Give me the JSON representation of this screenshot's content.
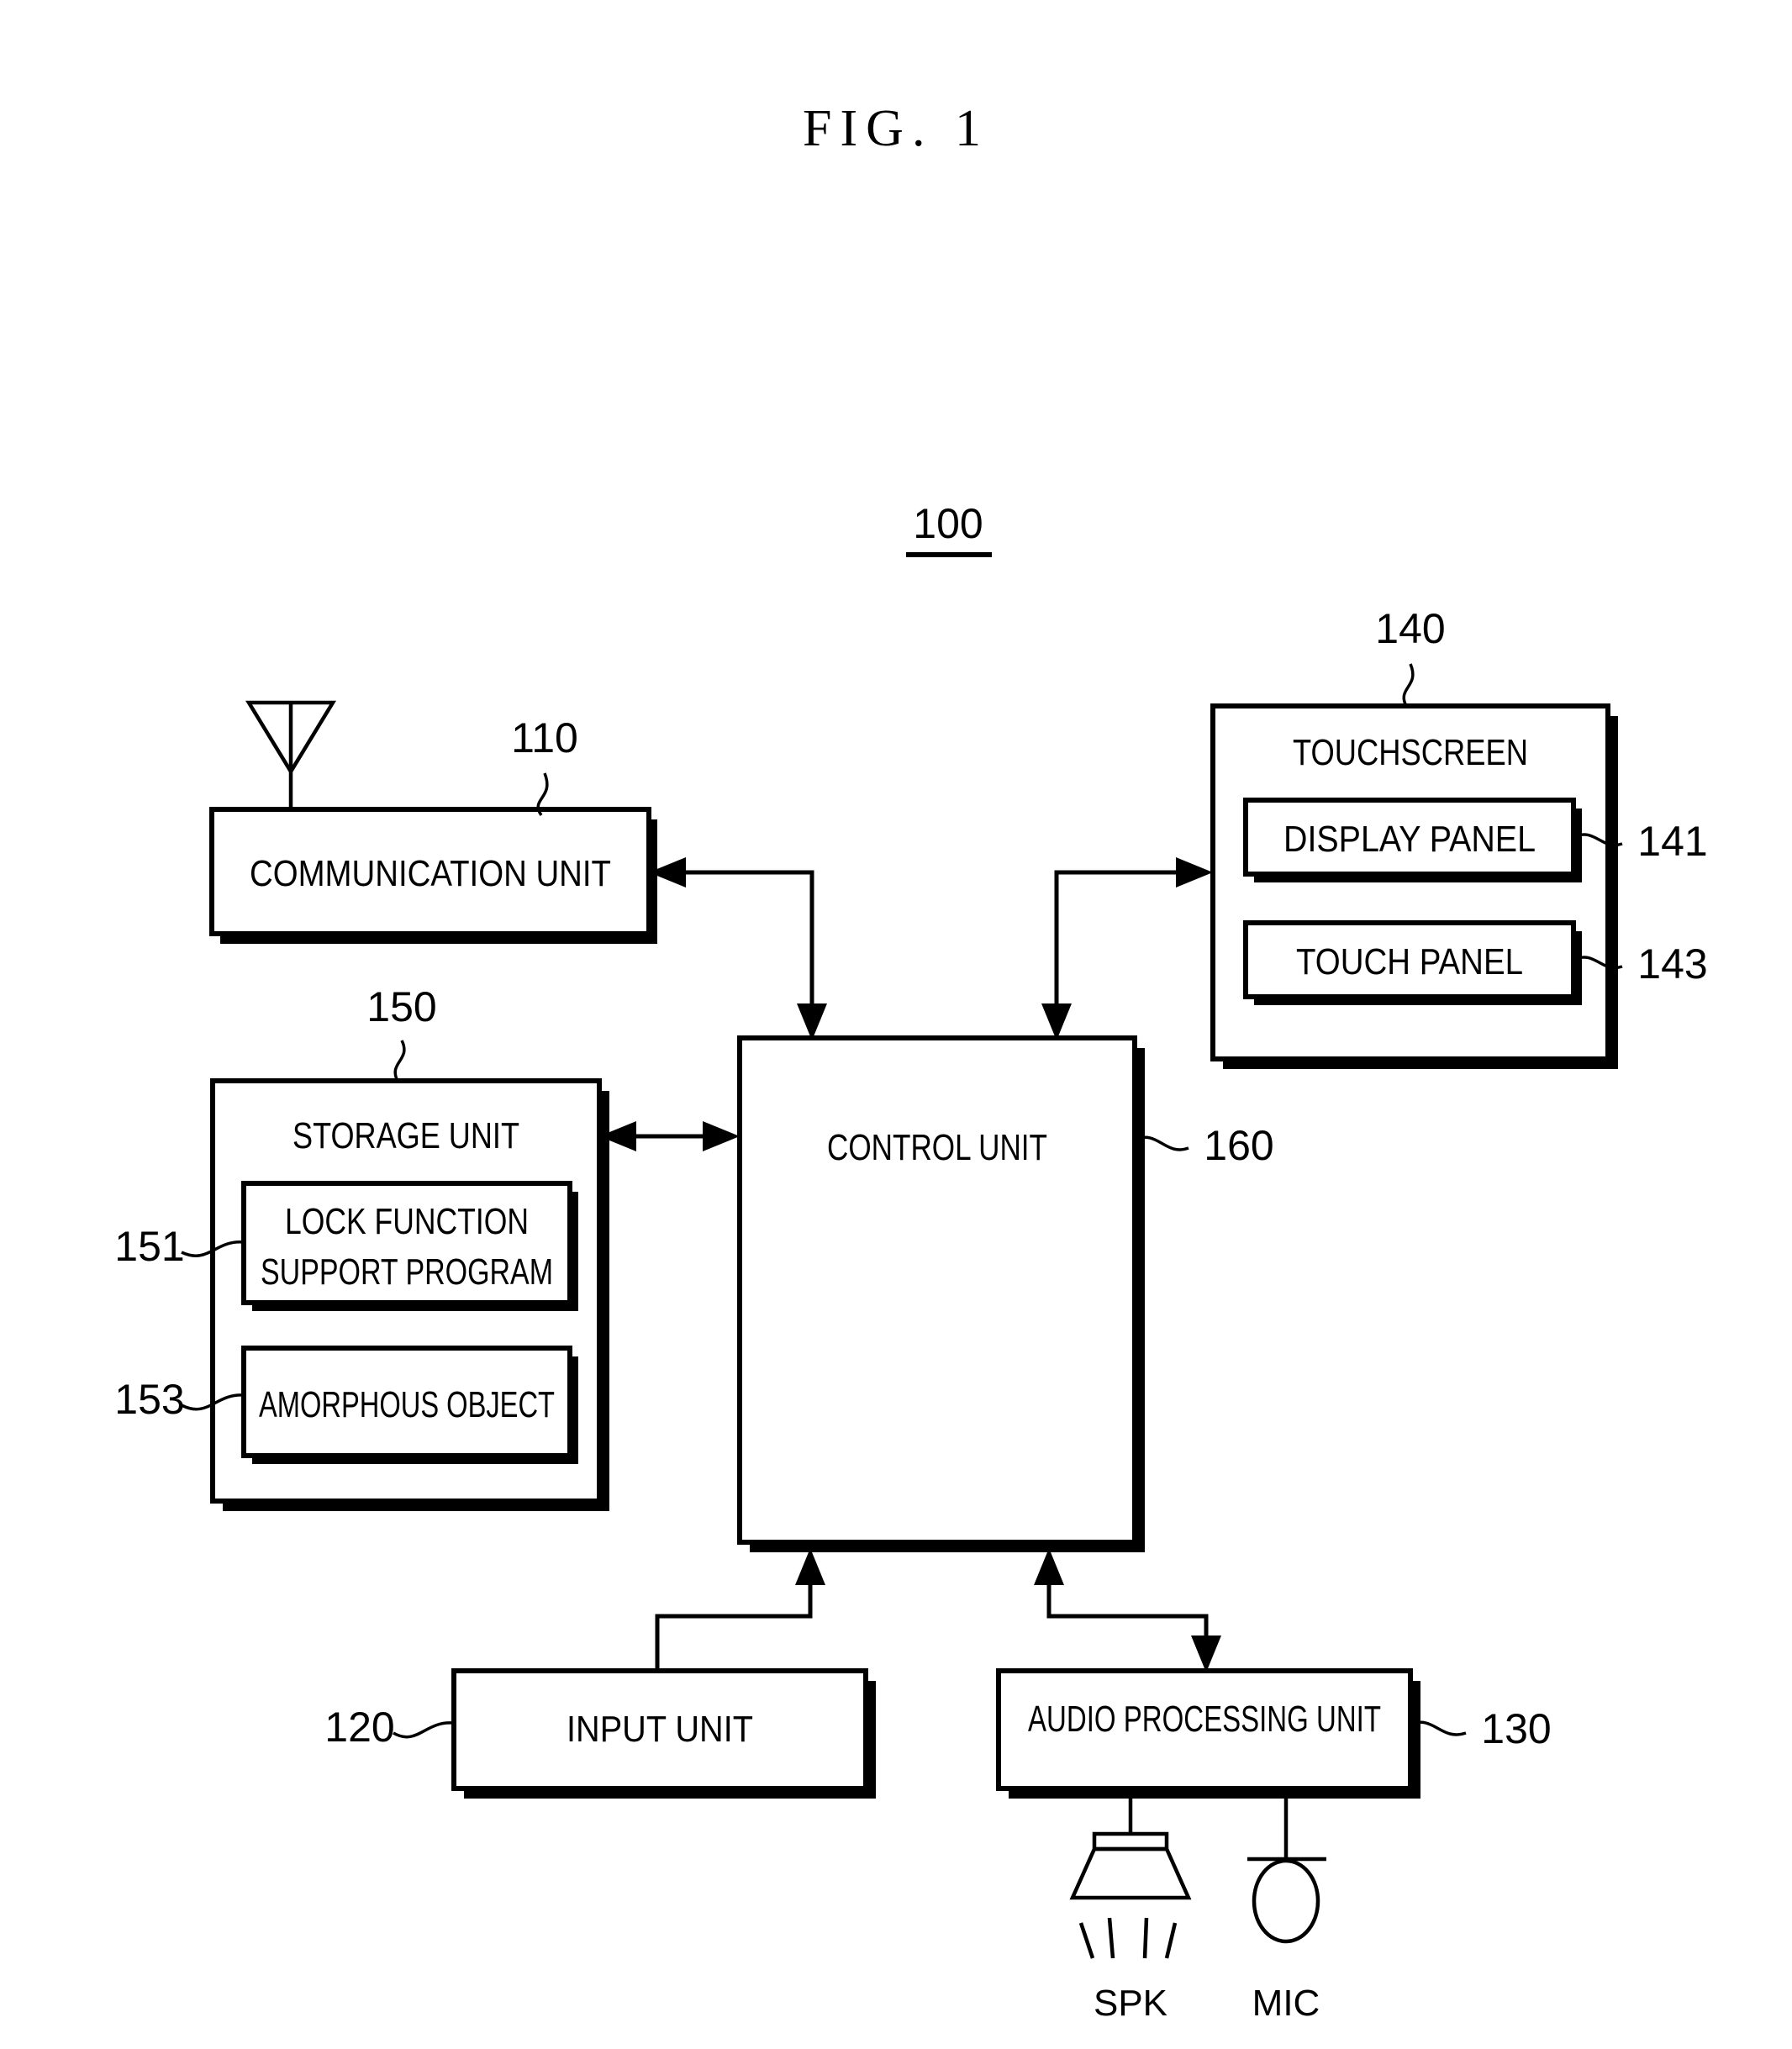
{
  "figure": {
    "title": "FIG. 1",
    "system_ref": "100"
  },
  "blocks": {
    "communication_unit": {
      "label": "COMMUNICATION UNIT",
      "ref": "110"
    },
    "touchscreen": {
      "label": "TOUCHSCREEN",
      "ref": "140"
    },
    "display_panel": {
      "label": "DISPLAY PANEL",
      "ref": "141"
    },
    "touch_panel": {
      "label": "TOUCH PANEL",
      "ref": "143"
    },
    "storage_unit": {
      "label": "STORAGE UNIT",
      "ref": "150"
    },
    "lock_function_support_program": {
      "label_line1": "LOCK FUNCTION",
      "label_line2": "SUPPORT PROGRAM",
      "ref": "151"
    },
    "amorphous_object": {
      "label": "AMORPHOUS OBJECT",
      "ref": "153"
    },
    "control_unit": {
      "label": "CONTROL UNIT",
      "ref": "160"
    },
    "input_unit": {
      "label": "INPUT UNIT",
      "ref": "120"
    },
    "audio_processing_unit": {
      "label": "AUDIO PROCESSING UNIT",
      "ref": "130"
    },
    "speaker": {
      "label": "SPK"
    },
    "microphone": {
      "label": "MIC"
    }
  },
  "icons": {
    "antenna": "antenna-icon",
    "speaker": "speaker-icon",
    "microphone": "microphone-icon"
  },
  "colors": {
    "ink": "#000000",
    "paper": "#ffffff"
  }
}
